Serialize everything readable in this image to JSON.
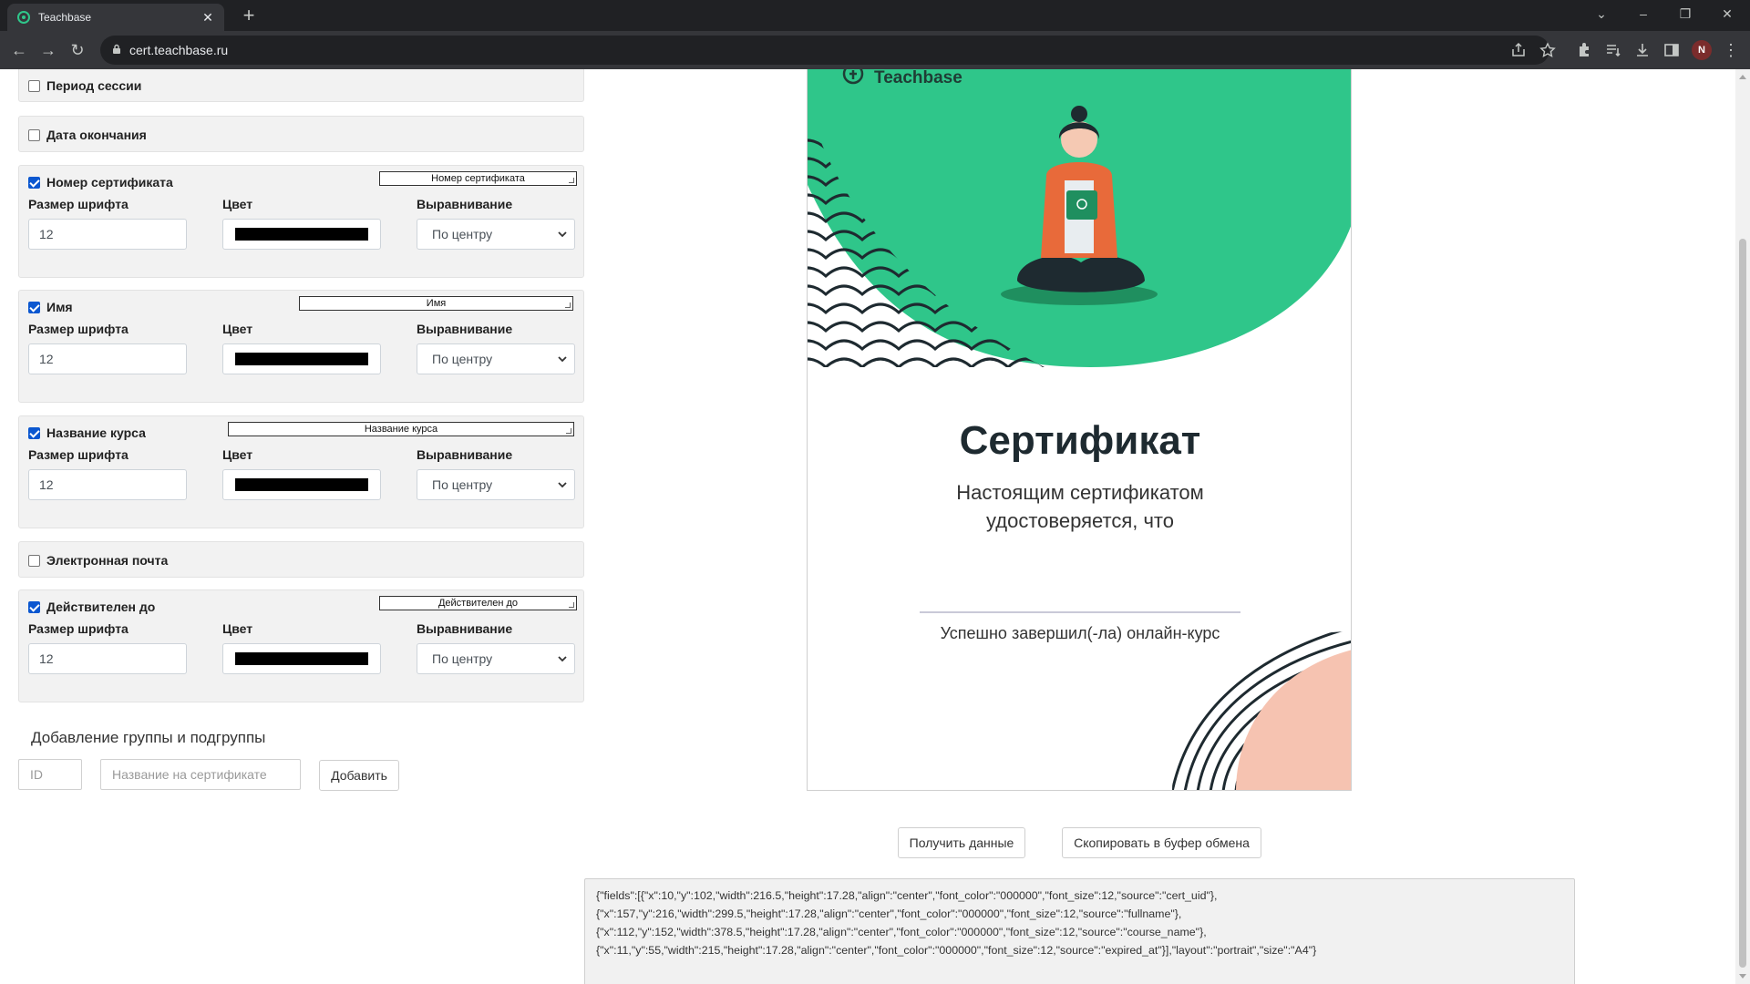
{
  "browser": {
    "tab_title": "Teachbase",
    "url": "cert.teachbase.ru",
    "avatar_letter": "N"
  },
  "fields": {
    "session_period": {
      "label": "Период сессии",
      "checked": false
    },
    "end_date": {
      "label": "Дата окончания",
      "checked": false
    },
    "cert_number": {
      "label": "Номер сертификата",
      "checked": true,
      "tag": "Номер сертификата",
      "font_size_label": "Размер шрифта",
      "color_label": "Цвет",
      "align_label": "Выравнивание",
      "font_size": "12",
      "align": "По центру",
      "color": "#000000"
    },
    "name": {
      "label": "Имя",
      "checked": true,
      "tag": "Имя",
      "font_size_label": "Размер шрифта",
      "color_label": "Цвет",
      "align_label": "Выравнивание",
      "font_size": "12",
      "align": "По центру",
      "color": "#000000"
    },
    "course_name": {
      "label": "Название курса",
      "checked": true,
      "tag": "Название курса",
      "font_size_label": "Размер шрифта",
      "color_label": "Цвет",
      "align_label": "Выравнивание",
      "font_size": "12",
      "align": "По центру",
      "color": "#000000"
    },
    "email": {
      "label": "Электронная почта",
      "checked": false
    },
    "valid_until": {
      "label": "Действителен до",
      "checked": true,
      "tag": "Действителен до",
      "font_size_label": "Размер шрифта",
      "color_label": "Цвет",
      "align_label": "Выравнивание",
      "font_size": "12",
      "align": "По центру",
      "color": "#000000"
    }
  },
  "group": {
    "title": "Добавление группы и подгруппы",
    "id_placeholder": "ID",
    "name_placeholder": "Название на сертификате",
    "add_label": "Добавить"
  },
  "certificate": {
    "logo": "Teachbase",
    "heading": "Сертификат",
    "subtitle_line1": "Настоящим сертификатом",
    "subtitle_line2": "удостоверяется, что",
    "completed": "Успешно завершил(-ла) онлайн-курс",
    "colors": {
      "green": "#2fc68a",
      "peach": "#f6c3b1",
      "dark": "#1e2a30"
    }
  },
  "actions": {
    "get_data": "Получить данные",
    "copy": "Скопировать в буфер обмена"
  },
  "json_output": {
    "line1": "{\"fields\":[{\"x\":10,\"y\":102,\"width\":216.5,\"height\":17.28,\"align\":\"center\",\"font_color\":\"000000\",\"font_size\":12,\"source\":\"cert_uid\"},",
    "line2": "{\"x\":157,\"y\":216,\"width\":299.5,\"height\":17.28,\"align\":\"center\",\"font_color\":\"000000\",\"font_size\":12,\"source\":\"fullname\"},",
    "line3": "{\"x\":112,\"y\":152,\"width\":378.5,\"height\":17.28,\"align\":\"center\",\"font_color\":\"000000\",\"font_size\":12,\"source\":\"course_name\"},",
    "line4": "{\"x\":11,\"y\":55,\"width\":215,\"height\":17.28,\"align\":\"center\",\"font_color\":\"000000\",\"font_size\":12,\"source\":\"expired_at\"}],\"layout\":\"portrait\",\"size\":\"A4\"}"
  }
}
